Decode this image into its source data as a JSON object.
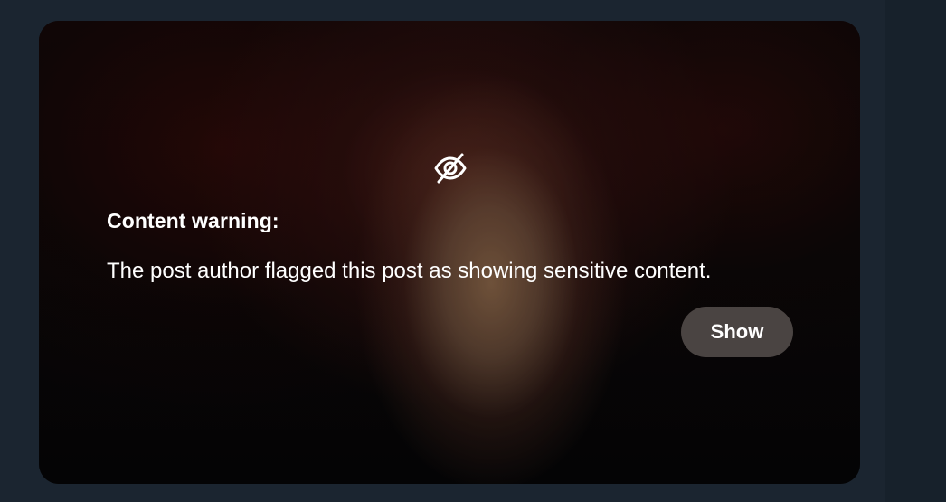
{
  "sensitive_media": {
    "icon": "eye-slash-icon",
    "title": "Content warning:",
    "message": "The post author flagged this post as showing sensitive content.",
    "show_label": "Show"
  },
  "colors": {
    "page_background": "#1b2530",
    "button_background": "#504a48",
    "text": "#ffffff"
  }
}
